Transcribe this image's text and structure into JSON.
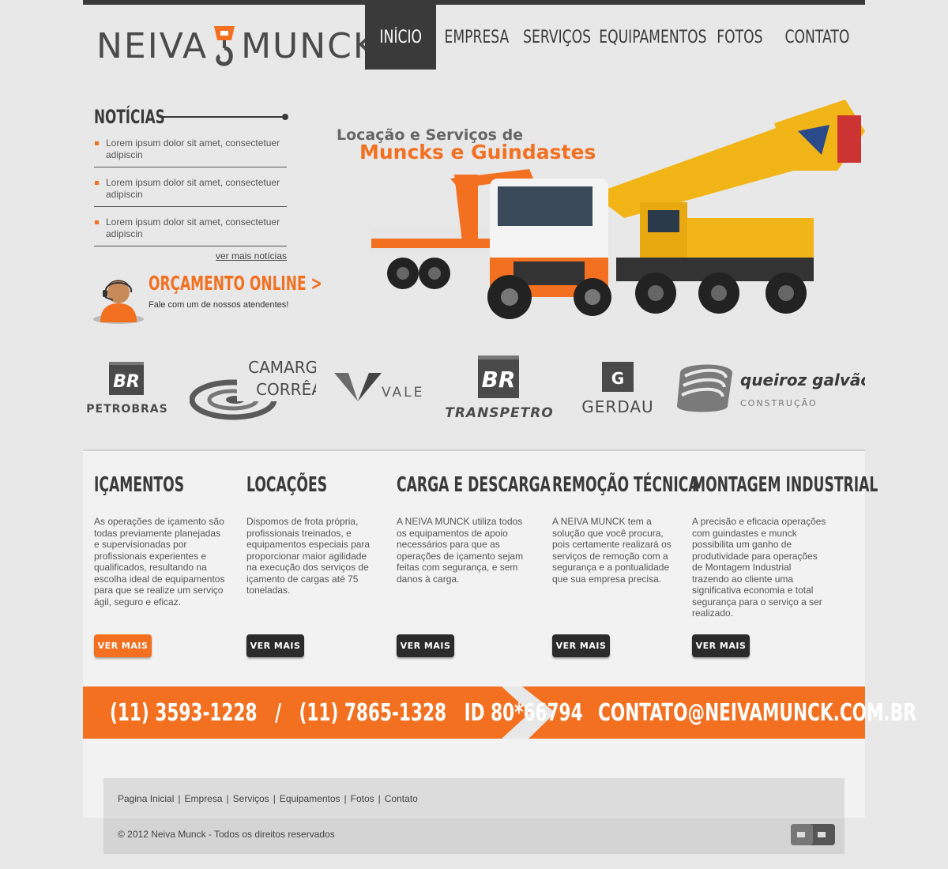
{
  "brand": {
    "name_left": "NEIVA",
    "name_right": "MUNCK"
  },
  "nav": {
    "items": [
      "INÍCIO",
      "EMPRESA",
      "SERVIÇOS",
      "EQUIPAMENTOS",
      "FOTOS",
      "CONTATO"
    ],
    "active": "INÍCIO"
  },
  "news": {
    "title": "NOTÍCIAS",
    "items": [
      "Lorem ipsum dolor sit amet, consectetuer adipiscin",
      "Lorem ipsum dolor sit amet, consectetuer adipiscin",
      "Lorem ipsum dolor sit amet, consectetuer adipiscin"
    ],
    "more": "ver mais notícias"
  },
  "quote": {
    "title": "ORÇAMENTO ONLINE >",
    "subtitle": "Fale com um de nossos atendentes!"
  },
  "hero": {
    "line1": "Locação e Serviços de",
    "line2": "Muncks e Guindastes"
  },
  "partners": {
    "petrobras": "PETROBRAS",
    "camargo_1": "CAMARGO",
    "camargo_2": "CORRÊA",
    "vale": "VALE",
    "transpetro": "TRANSPETRO",
    "gerdau": "GERDAU",
    "queiroz_1": "queiroz galvão",
    "queiroz_2": "CONSTRUÇÃO",
    "br": "BR",
    "gerdau_mark": "G"
  },
  "services": [
    {
      "title": "IÇAMENTOS",
      "text": "As operações de içamento são todas previamente planejadas e supervisionadas por profissionais experientes e qualificados, resultando na escolha ideal de equipamentos para que se realize um serviço ágil, seguro e eficaz.",
      "button": "VER MAIS"
    },
    {
      "title": "LOCAÇÕES",
      "text": "Dispomos de frota própria, profissionais treinados, e equipamentos especiais para proporcionar maior agilidade na execução dos serviços de içamento de cargas até 75 toneladas.",
      "button": "VER MAIS"
    },
    {
      "title": "CARGA E DESCARGA",
      "text": "A NEIVA MUNCK utiliza todos os equipamentos de apoio necessários para que as operações de içamento sejam feitas com segurança, e sem danos à carga.",
      "button": "VER MAIS"
    },
    {
      "title": "REMOÇÃO TÉCNICA",
      "text": "A NEIVA MUNCK tem a solução que você procura, pois certamente realizará os serviços de remoção com a segurança e a pontualidade que sua empresa precisa.",
      "button": "VER MAIS"
    },
    {
      "title": "MONTAGEM INDUSTRIAL",
      "text": "A precisão e eficacia operações com guindastes e munck possibilita um ganho de produtividade para operações de Montagem Industrial trazendo ao cliente uma significativa economia e total segurança para o serviço a ser realizado.",
      "button": "VER MAIS"
    }
  ],
  "contact": {
    "phones": "(11) 3593-1228   /   (11) 7865-1328   ID 80*66794",
    "email": "CONTATO@NEIVAMUNCK.COM.BR"
  },
  "footer": {
    "links": [
      "Pagina Inicial",
      "Empresa",
      "Serviços",
      "Equipamentos",
      "Fotos",
      "Contato"
    ],
    "separator": "|",
    "copyright": "© 2012 Neiva Munck - Todos os direitos reservados"
  },
  "colors": {
    "accent": "#f37021",
    "dark": "#3a3a3a",
    "page_bg": "#e8e8e8"
  }
}
